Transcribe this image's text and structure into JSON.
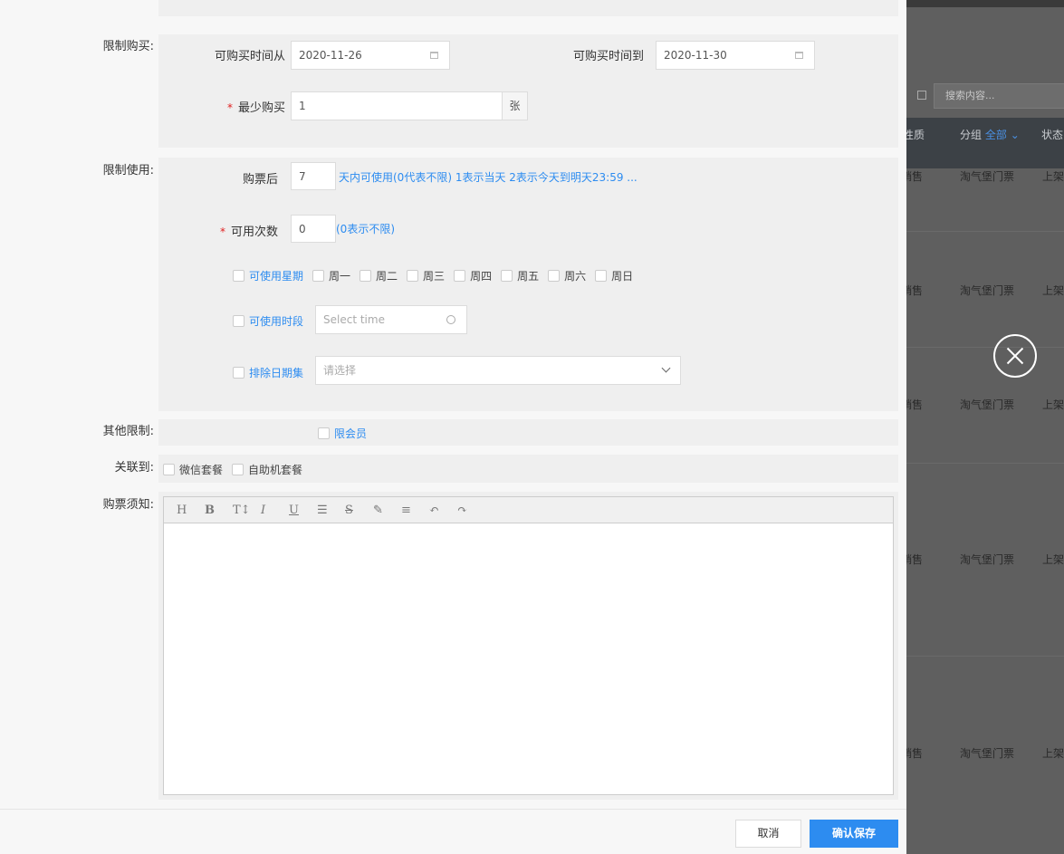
{
  "background": {
    "search_placeholder": "搜索内容...",
    "columns": {
      "nature": "性质",
      "group": "分组",
      "group_filter": "全部",
      "status": "状态"
    },
    "rows": [
      {
        "type": "销售",
        "group": "淘气堡门票",
        "status": "上架"
      },
      {
        "type": "销售",
        "group": "淘气堡门票",
        "status": "上架"
      },
      {
        "type": "销售",
        "group": "淘气堡门票",
        "status": "上架"
      },
      {
        "type": "销售",
        "group": "淘气堡门票",
        "status": "上架"
      },
      {
        "type": "销售",
        "group": "淘气堡门票",
        "status": "上架"
      }
    ]
  },
  "form": {
    "purchase_limit": {
      "label": "限制购买:",
      "from_label": "可购买时间从",
      "from_value": "2020-11-26",
      "to_label": "可购买时间到",
      "to_value": "2020-11-30",
      "min_label": "最少购买",
      "min_value": "1",
      "min_unit": "张"
    },
    "usage_limit": {
      "label": "限制使用:",
      "after_label": "购票后",
      "after_value": "7",
      "after_hint": "天内可使用(0代表不限) 1表示当天 2表示今天到明天23:59 ...",
      "times_label": "可用次数",
      "times_value": "0",
      "times_hint": "(0表示不限)",
      "weekday_label": "可使用星期",
      "weekdays": [
        "周一",
        "周二",
        "周三",
        "周四",
        "周五",
        "周六",
        "周日"
      ],
      "period_label": "可使用时段",
      "period_placeholder": "Select time",
      "exclude_label": "排除日期集",
      "exclude_placeholder": "请选择"
    },
    "other_limit": {
      "label": "其他限制:",
      "member_only": "限会员"
    },
    "link_to": {
      "label": "关联到:",
      "options": [
        "微信套餐",
        "自助机套餐"
      ]
    },
    "notice": {
      "label": "购票须知:",
      "toolbar": [
        "H",
        "B",
        "T↕",
        "I",
        "U",
        "☰",
        "S",
        "✎",
        "≡",
        "↶",
        "↷"
      ]
    }
  },
  "footer": {
    "cancel_label": "取消",
    "save_label": "确认保存"
  }
}
